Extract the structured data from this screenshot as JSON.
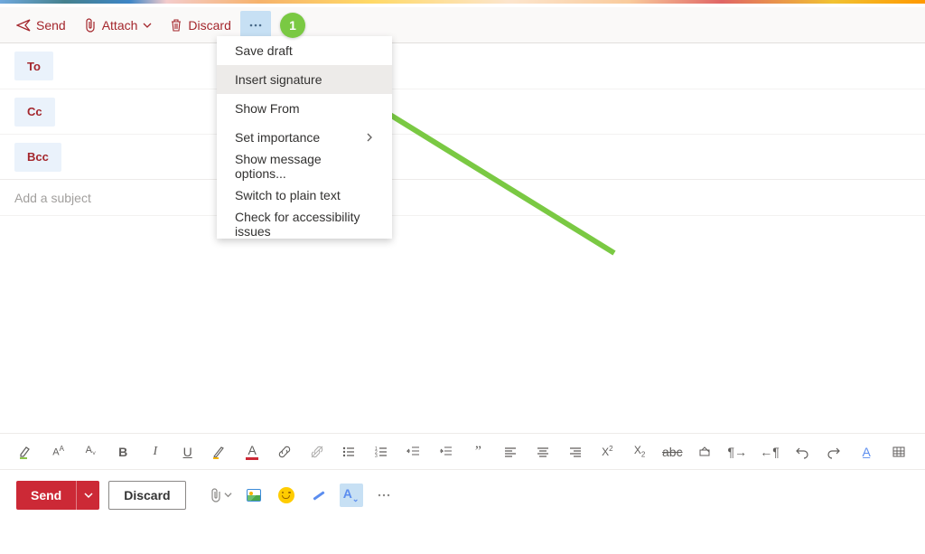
{
  "toolbar": {
    "send": "Send",
    "attach": "Attach",
    "discard": "Discard"
  },
  "menu": {
    "items": [
      {
        "label": "Save draft",
        "submenu": false,
        "active": false
      },
      {
        "label": "Insert signature",
        "submenu": false,
        "active": true
      },
      {
        "label": "Show From",
        "submenu": false,
        "active": false
      },
      {
        "label": "Set importance",
        "submenu": true,
        "active": false
      },
      {
        "label": "Show message options...",
        "submenu": false,
        "active": false
      },
      {
        "label": "Switch to plain text",
        "submenu": false,
        "active": false
      },
      {
        "label": "Check for accessibility issues",
        "submenu": false,
        "active": false
      }
    ]
  },
  "recipients": {
    "to": "To",
    "cc": "Cc",
    "bcc": "Bcc"
  },
  "subject": {
    "placeholder": "Add a subject",
    "value": ""
  },
  "format_icons": [
    "pen-highlight",
    "font-plus",
    "font-minus",
    "bold",
    "italic",
    "underline",
    "pencil",
    "font-color",
    "link",
    "unlink",
    "bullets",
    "numbered",
    "outdent",
    "indent",
    "quote",
    "align-left",
    "align-center",
    "align-right",
    "superscript",
    "subscript",
    "strikethrough",
    "clear-format",
    "ltr",
    "rtl",
    "undo",
    "redo",
    "text-effects",
    "table"
  ],
  "footer": {
    "send": "Send",
    "discard": "Discard"
  },
  "annotation": {
    "step": "1"
  }
}
